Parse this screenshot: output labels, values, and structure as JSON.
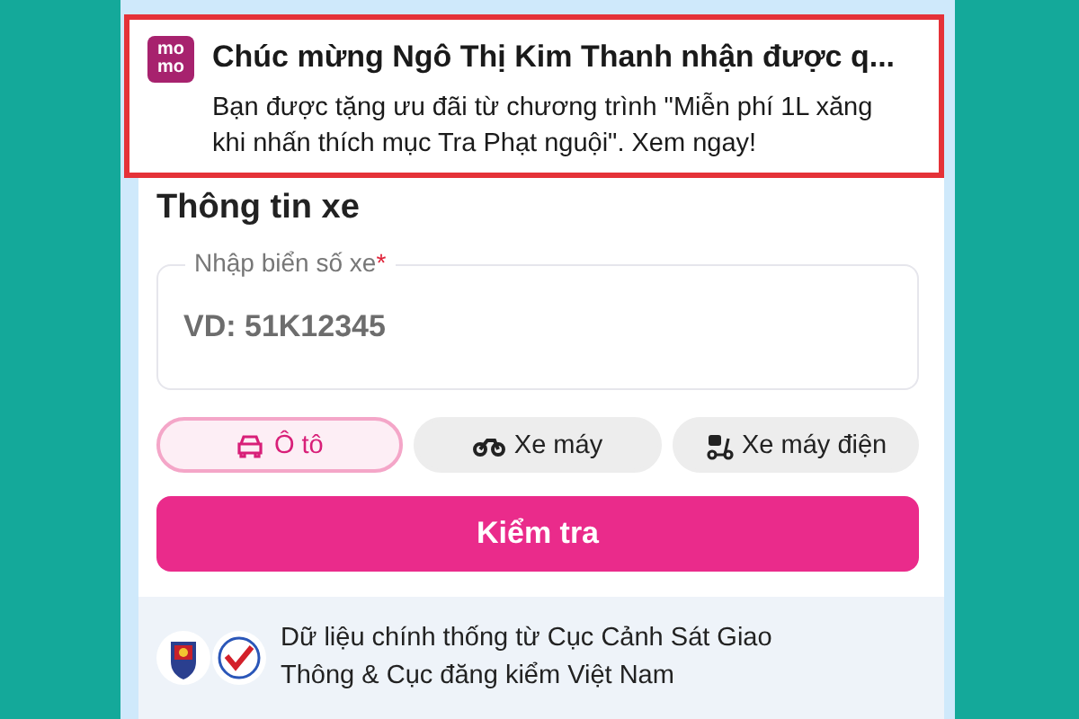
{
  "notification": {
    "logo_lines": [
      "mo",
      "mo"
    ],
    "title": "Chúc mừng Ngô Thị Kim Thanh nhận được q...",
    "body": "Bạn được tặng ưu đãi từ chương trình \"Miễn phí 1L xăng khi nhấn thích mục Tra Phạt nguội\". Xem ngay!"
  },
  "section_title": "Thông tin xe",
  "plate_field": {
    "label": "Nhập biển số xe",
    "required_mark": "*",
    "placeholder": "VD: 51K12345"
  },
  "vehicle_types": [
    {
      "kind": "car",
      "label": "Ô tô",
      "selected": true
    },
    {
      "kind": "motorbike",
      "label": "Xe máy",
      "selected": false
    },
    {
      "kind": "ebike",
      "label": "Xe máy điện",
      "selected": false
    }
  ],
  "check_button": "Kiểm tra",
  "footer": {
    "text": "Dữ liệu chính thống từ Cục Cảnh Sát Giao Thông & Cục đăng kiểm Việt Nam"
  }
}
